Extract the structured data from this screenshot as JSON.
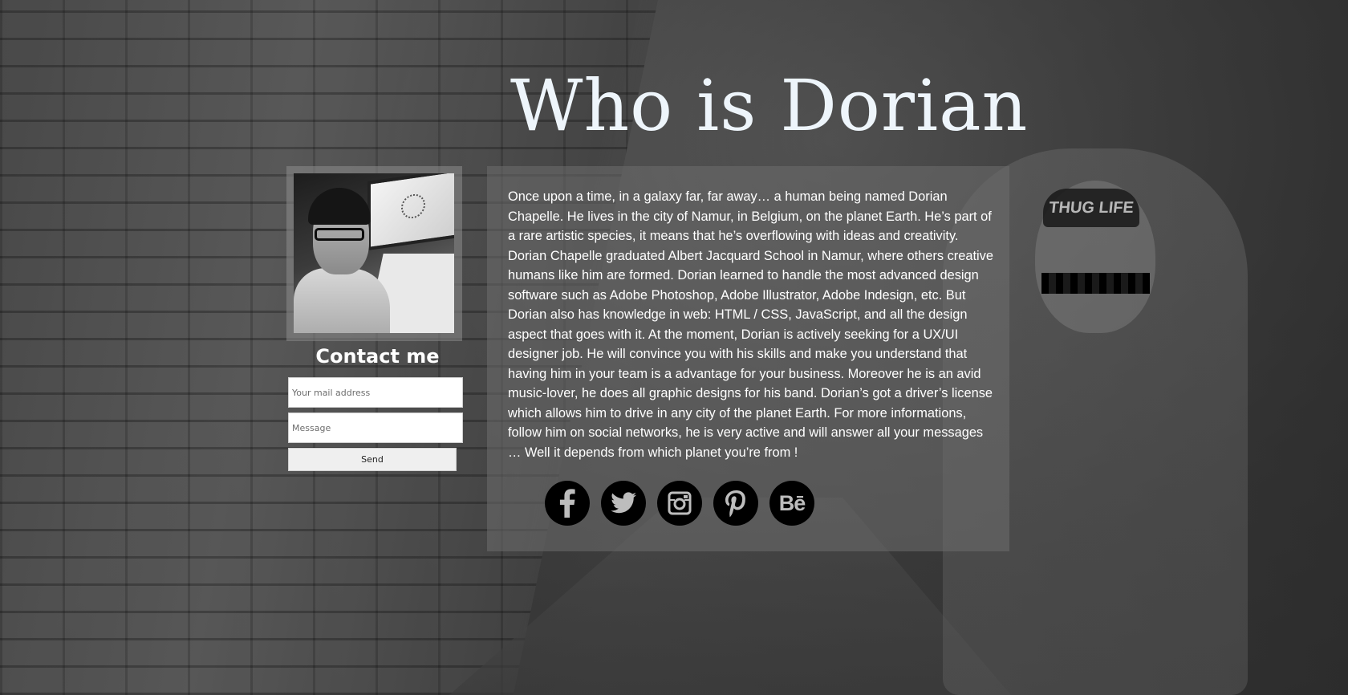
{
  "page": {
    "title": "Who is Dorian"
  },
  "background": {
    "cap_text": "THUG LIFE"
  },
  "contact": {
    "heading": "Contact me",
    "email_placeholder": "Your mail address",
    "message_placeholder": "Message",
    "send_label": "Send"
  },
  "bio": {
    "text": "Once upon a time, in a galaxy far, far away… a human being named Dorian Chapelle. He lives in the city of Namur, in Belgium, on the planet Earth. He’s part of a rare artistic species, it means that he’s overflowing with ideas and creativity. Dorian Chapelle graduated Albert Jacquard School in Namur, where others creative humans like him are formed. Dorian learned to handle the most advanced design software such as Adobe Photoshop, Adobe Illustrator, Adobe Indesign, etc. But Dorian also has knowledge in web: HTML / CSS, JavaScript, and all the design aspect that goes with it. At the moment, Dorian is actively seeking for a UX/UI designer job. He will convince you with his skills and make you understand that having him in your team is a advantage for your business. Moreover he is an avid music-lover, he does all graphic designs for his band. Dorian’s got a driver’s license which allows him to drive in any city of the planet Earth. For more informations, follow him on social networks, he is very active and will answer all your messages … Well it depends from which planet you’re from !"
  },
  "socials": [
    {
      "icon": "facebook-icon"
    },
    {
      "icon": "twitter-icon"
    },
    {
      "icon": "instagram-icon"
    },
    {
      "icon": "pinterest-icon"
    },
    {
      "icon": "behance-icon",
      "glyph": "Bē"
    }
  ],
  "colors": {
    "title": "#eef5fb",
    "panel": "rgba(110,110,110,0.55)",
    "social_bg": "#000000",
    "social_fg": "#bdbdbd"
  }
}
